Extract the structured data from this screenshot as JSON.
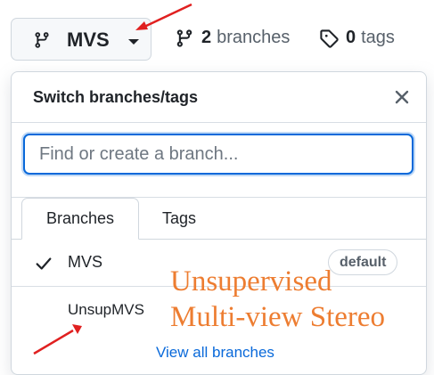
{
  "branch_button": {
    "name": "MVS",
    "branch_icon": "git-branch-icon",
    "caret_icon": "triangle-down-icon"
  },
  "stats": {
    "branches_count": "2",
    "branches_label": "branches",
    "tags_count": "0",
    "tags_label": "tags",
    "branches_icon": "git-branch-icon",
    "tags_icon": "tag-icon"
  },
  "dropdown": {
    "title": "Switch branches/tags",
    "close_icon": "x-icon",
    "search_placeholder": "Find or create a branch...",
    "search_value": "",
    "tabs": [
      {
        "label": "Branches",
        "selected": true
      },
      {
        "label": "Tags",
        "selected": false
      }
    ],
    "branches": [
      {
        "name": "MVS",
        "checked": true,
        "badge": "default"
      },
      {
        "name": "UnsupMVS",
        "checked": false,
        "badge": ""
      }
    ],
    "view_all": "View all branches"
  },
  "annotation": {
    "line1": "Unsupervised",
    "line2": "Multi-view Stereo",
    "color": "#ed7d31",
    "arrow_color": "#e02020"
  },
  "colors": {
    "accent": "#0969da",
    "text": "#1f2328",
    "muted": "#57606a",
    "border": "#d0d7de"
  }
}
